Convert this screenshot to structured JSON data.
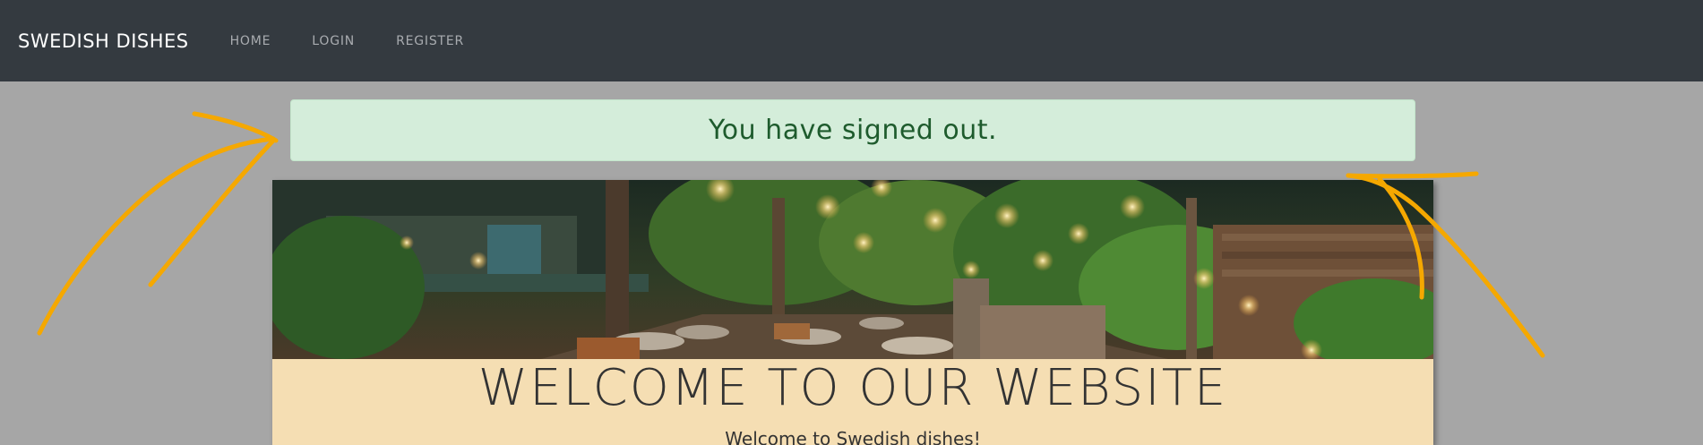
{
  "navbar": {
    "brand": "SWEDISH DISHES",
    "links": [
      {
        "label": "HOME"
      },
      {
        "label": "LOGIN"
      },
      {
        "label": "REGISTER"
      }
    ]
  },
  "alert": {
    "message": "You have signed out."
  },
  "welcome": {
    "title": "WELCOME TO OUR WEBSITE",
    "subtitle": "Welcome to Swedish dishes!"
  },
  "colors": {
    "navbar": "#343a40",
    "page_background": "#a6a6a6",
    "alert_background": "#d4edda",
    "alert_text": "#1e5b2d",
    "card_background": "#f5deb3",
    "annotation_stroke": "#f5a800"
  },
  "icons": {
    "hero_image": "restaurant-garden-patio-photo",
    "annotations": "hand-drawn-arrows"
  }
}
